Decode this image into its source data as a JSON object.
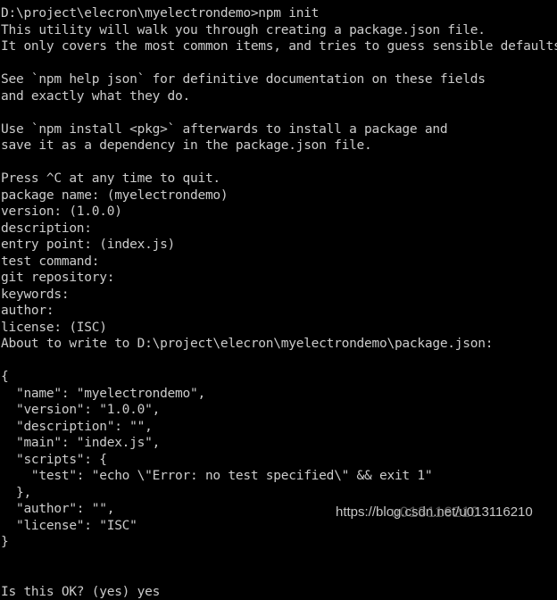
{
  "terminal": {
    "background_color": "#000000",
    "text_color": "#cccccc",
    "lines": [
      "D:\\project\\elecron\\myelectrondemo>npm init",
      "This utility will walk you through creating a package.json file.",
      "It only covers the most common items, and tries to guess sensible defaults.",
      "",
      "See `npm help json` for definitive documentation on these fields",
      "and exactly what they do.",
      "",
      "Use `npm install <pkg>` afterwards to install a package and",
      "save it as a dependency in the package.json file.",
      "",
      "Press ^C at any time to quit.",
      "package name: (myelectrondemo)",
      "version: (1.0.0)",
      "description:",
      "entry point: (index.js)",
      "test command:",
      "git repository:",
      "keywords:",
      "author:",
      "license: (ISC)",
      "About to write to D:\\project\\elecron\\myelectrondemo\\package.json:",
      "",
      "{",
      "  \"name\": \"myelectrondemo\",",
      "  \"version\": \"1.0.0\",",
      "  \"description\": \"\",",
      "  \"main\": \"index.js\",",
      "  \"scripts\": {",
      "    \"test\": \"echo \\\"Error: no test specified\\\" && exit 1\"",
      "  },",
      "  \"author\": \"\",",
      "  \"license\": \"ISC\"",
      "}",
      "",
      "",
      "Is this OK? (yes) yes"
    ]
  },
  "watermark": {
    "url": "https://blog.csdn.net/u013116210",
    "ghost_text": "u013116210",
    "color": "#d8d8d8"
  }
}
